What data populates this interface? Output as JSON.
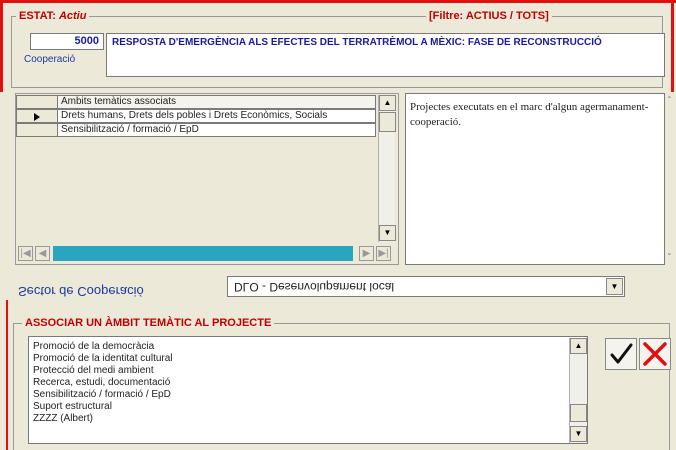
{
  "header": {
    "estat_label": "ESTAT:",
    "estat_value": "Actiu",
    "filter": "[Filtre: ACTIUS / TOTS]",
    "code": "5000",
    "title": "RESPOSTA D'EMERGÈNCIA ALS EFECTES DEL TERRATRÈMOL A MÈXIC: FASE DE RECONSTRUCCIÓ",
    "type_label": "Cooperació"
  },
  "grid": {
    "header": "Àmbits temàtics associats",
    "rows": [
      "Drets humans, Drets dels pobles i Drets Econòmics, Socials",
      "Sensibilització / formació / EpD"
    ]
  },
  "description": "Projectes executats en el marc d'algun agermanament-cooperació.",
  "sector": {
    "label": "Sector de Cooperació",
    "value": "DLO - Desenvolupament local"
  },
  "associate": {
    "legend": "ASSOCIAR UN ÀMBIT TEMÀTIC AL PROJECTE",
    "items": [
      "Promoció de la democràcia",
      "Promoció de la identitat cultural",
      "Protecció del medi ambient",
      "Recerca, estudi, documentació",
      "Sensibilització / formació / EpD",
      "Suport estructural",
      "ZZZZ (Albert)"
    ]
  },
  "colors": {
    "accent_red": "#c00000",
    "frame_red": "#e01010",
    "label_blue": "#1a3aa0",
    "scrollbar_cyan": "#2aa5c0"
  }
}
